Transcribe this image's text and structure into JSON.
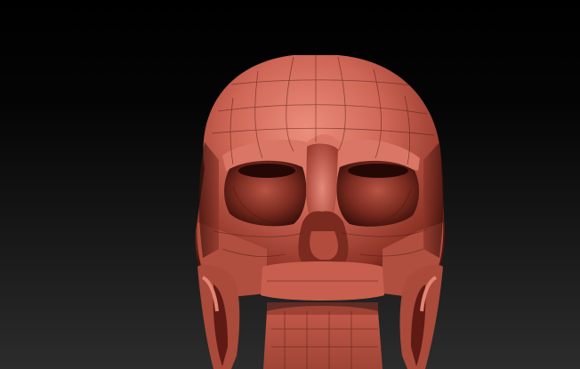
{
  "viewport": {
    "content": "3d-mesh",
    "subject": "skull-head",
    "background_top": "#000000",
    "background_bottom": "#2c2c2c",
    "mesh_base_color": "#c45a4a",
    "mesh_highlight_color": "#ec8e7c",
    "mesh_shadow_color": "#3a0f0b",
    "wire_color": "#4a1510",
    "grid_visible": true
  }
}
